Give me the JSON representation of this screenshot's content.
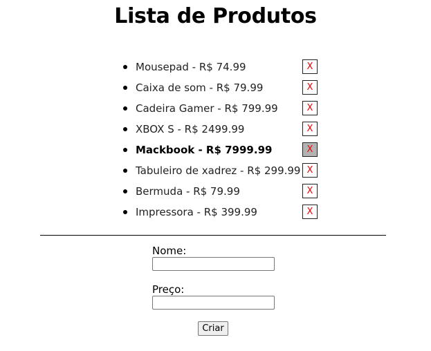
{
  "page": {
    "title": "Lista de Produtos"
  },
  "products": [
    {
      "text": "Mousepad - R$ 74.99",
      "delete_label": "X",
      "selected": false
    },
    {
      "text": "Caixa de som - R$ 79.99",
      "delete_label": "X",
      "selected": false
    },
    {
      "text": "Cadeira Gamer - R$ 799.99",
      "delete_label": "X",
      "selected": false
    },
    {
      "text": "XBOX S - R$ 2499.99",
      "delete_label": "X",
      "selected": false
    },
    {
      "text": "Mackbook - R$ 7999.99",
      "delete_label": "X",
      "selected": true
    },
    {
      "text": "Tabuleiro de xadrez - R$ 299.99",
      "delete_label": "X",
      "selected": false
    },
    {
      "text": "Bermuda - R$ 79.99",
      "delete_label": "X",
      "selected": false
    },
    {
      "text": "Impressora - R$ 399.99",
      "delete_label": "X",
      "selected": false
    }
  ],
  "form": {
    "name_label": "Nome:",
    "name_value": "",
    "price_label": "Preço:",
    "price_value": "",
    "submit_label": "Criar"
  },
  "colors": {
    "delete_text": "#ee0000",
    "selected_delete_bg": "#b3b3b3"
  }
}
